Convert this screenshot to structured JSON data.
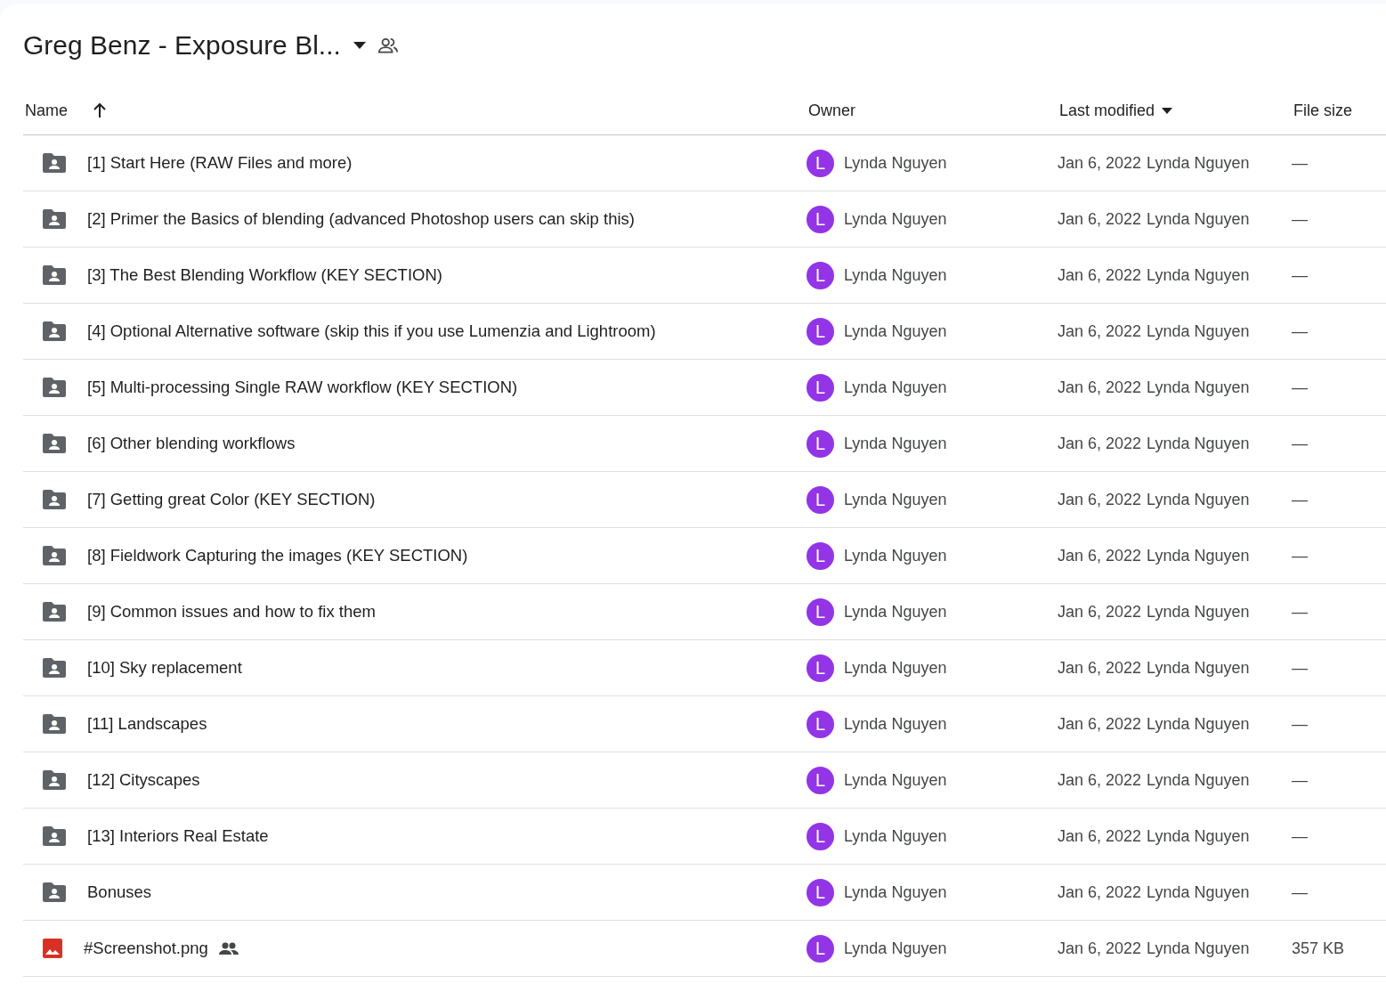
{
  "header": {
    "title": "Greg Benz - Exposure Bl...",
    "has_dropdown": true,
    "shared": true
  },
  "table": {
    "columns": [
      {
        "label": "Name",
        "kind": "arrow",
        "sorted": true
      },
      {
        "label": "Owner",
        "kind": "plain",
        "sorted": false
      },
      {
        "label": "Last modified",
        "kind": "caret",
        "sorted": true
      },
      {
        "label": "File size",
        "kind": "plain",
        "sorted": false
      }
    ],
    "rows": [
      {
        "kind": "folder",
        "name": "[1] Start Here (RAW Files and more)",
        "shared": false,
        "owner_initial": "L",
        "owner": "Lynda Nguyen",
        "modified": "Jan 6, 2022",
        "modified_by": "Lynda Nguyen",
        "size": "—"
      },
      {
        "kind": "folder",
        "name": "[2] Primer the Basics of blending (advanced Photoshop users can skip this)",
        "shared": false,
        "owner_initial": "L",
        "owner": "Lynda Nguyen",
        "modified": "Jan 6, 2022",
        "modified_by": "Lynda Nguyen",
        "size": "—"
      },
      {
        "kind": "folder",
        "name": "[3] The Best Blending Workflow (KEY SECTION)",
        "shared": false,
        "owner_initial": "L",
        "owner": "Lynda Nguyen",
        "modified": "Jan 6, 2022",
        "modified_by": "Lynda Nguyen",
        "size": "—"
      },
      {
        "kind": "folder",
        "name": "[4] Optional Alternative software (skip this if you use Lumenzia and Lightroom)",
        "shared": false,
        "owner_initial": "L",
        "owner": "Lynda Nguyen",
        "modified": "Jan 6, 2022",
        "modified_by": "Lynda Nguyen",
        "size": "—"
      },
      {
        "kind": "folder",
        "name": "[5] Multi-processing Single RAW workflow (KEY SECTION)",
        "shared": false,
        "owner_initial": "L",
        "owner": "Lynda Nguyen",
        "modified": "Jan 6, 2022",
        "modified_by": "Lynda Nguyen",
        "size": "—"
      },
      {
        "kind": "folder",
        "name": "[6] Other blending workflows",
        "shared": false,
        "owner_initial": "L",
        "owner": "Lynda Nguyen",
        "modified": "Jan 6, 2022",
        "modified_by": "Lynda Nguyen",
        "size": "—"
      },
      {
        "kind": "folder",
        "name": "[7] Getting great Color (KEY SECTION)",
        "shared": false,
        "owner_initial": "L",
        "owner": "Lynda Nguyen",
        "modified": "Jan 6, 2022",
        "modified_by": "Lynda Nguyen",
        "size": "—"
      },
      {
        "kind": "folder",
        "name": "[8] Fieldwork Capturing the images (KEY SECTION)",
        "shared": false,
        "owner_initial": "L",
        "owner": "Lynda Nguyen",
        "modified": "Jan 6, 2022",
        "modified_by": "Lynda Nguyen",
        "size": "—"
      },
      {
        "kind": "folder",
        "name": "[9] Common issues and how to fix them",
        "shared": false,
        "owner_initial": "L",
        "owner": "Lynda Nguyen",
        "modified": "Jan 6, 2022",
        "modified_by": "Lynda Nguyen",
        "size": "—"
      },
      {
        "kind": "folder",
        "name": "[10] Sky replacement",
        "shared": false,
        "owner_initial": "L",
        "owner": "Lynda Nguyen",
        "modified": "Jan 6, 2022",
        "modified_by": "Lynda Nguyen",
        "size": "—"
      },
      {
        "kind": "folder",
        "name": "[11] Landscapes",
        "shared": false,
        "owner_initial": "L",
        "owner": "Lynda Nguyen",
        "modified": "Jan 6, 2022",
        "modified_by": "Lynda Nguyen",
        "size": "—"
      },
      {
        "kind": "folder",
        "name": "[12] Cityscapes",
        "shared": false,
        "owner_initial": "L",
        "owner": "Lynda Nguyen",
        "modified": "Jan 6, 2022",
        "modified_by": "Lynda Nguyen",
        "size": "—"
      },
      {
        "kind": "folder",
        "name": "[13] Interiors Real Estate",
        "shared": false,
        "owner_initial": "L",
        "owner": "Lynda Nguyen",
        "modified": "Jan 6, 2022",
        "modified_by": "Lynda Nguyen",
        "size": "—"
      },
      {
        "kind": "folder",
        "name": "Bonuses",
        "shared": false,
        "owner_initial": "L",
        "owner": "Lynda Nguyen",
        "modified": "Jan 6, 2022",
        "modified_by": "Lynda Nguyen",
        "size": "—"
      },
      {
        "kind": "image",
        "name": "#Screenshot.png",
        "shared": true,
        "owner_initial": "L",
        "owner": "Lynda Nguyen",
        "modified": "Jan 6, 2022",
        "modified_by": "Lynda Nguyen",
        "size": "357 KB"
      }
    ]
  }
}
